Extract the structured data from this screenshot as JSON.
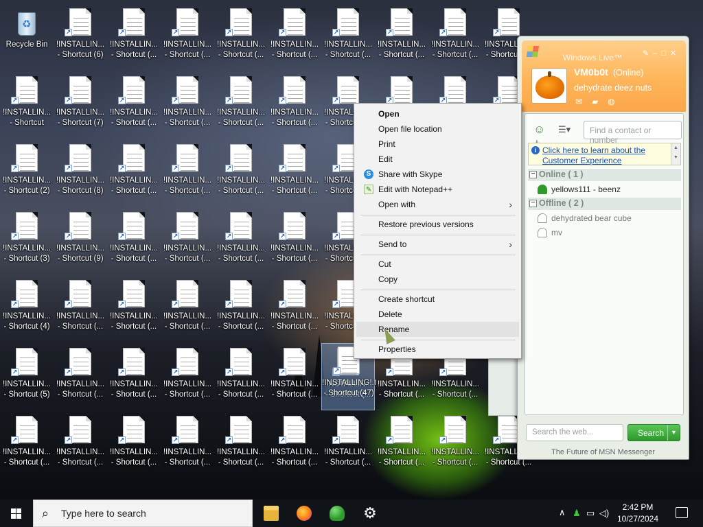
{
  "desktop": {
    "recycle_bin": "Recycle Bin",
    "shortcut_line1": "!INSTALLIN...",
    "rows": [
      [
        "- Shortcut (6)",
        "- Shortcut (...",
        "- Shortcut (...",
        "- Shortcut (...",
        "- Shortcut (...",
        "- Shortcut (...",
        "- Shortcut (...",
        "- Shortcut (...",
        "- Shortcut (..."
      ],
      [
        "- Shortcut",
        "- Shortcut (7)",
        "- Shortcut (...",
        "- Shortcut (...",
        "- Shortcut (...",
        "- Shortcut (...",
        "- Shortcut (...",
        "- Shortcut (...",
        "- Shortcut (...",
        "- Shortcut (..."
      ],
      [
        "- Shortcut (2)",
        "- Shortcut (8)",
        "- Shortcut (...",
        "- Shortcut (...",
        "- Shortcut (...",
        "- Shortcut (...",
        "- Shortcut (..."
      ],
      [
        "- Shortcut (3)",
        "- Shortcut (9)",
        "- Shortcut (...",
        "- Shortcut (...",
        "- Shortcut (...",
        "- Shortcut (...",
        "- Shortcut (..."
      ],
      [
        "- Shortcut (4)",
        "- Shortcut (...",
        "- Shortcut (...",
        "- Shortcut (...",
        "- Shortcut (...",
        "- Shortcut (...",
        "- Shortcut (..."
      ],
      [
        "- Shortcut (5)",
        "- Shortcut (...",
        "- Shortcut (...",
        "- Shortcut (...",
        "- Shortcut (...",
        "- Shortcut (...",
        "- Shortcut (...",
        "- Shortcut (...",
        "- Shortcut (..."
      ],
      [
        "- Shortcut (...",
        "- Shortcut (...",
        "- Shortcut (...",
        "- Shortcut (...",
        "- Shortcut (...",
        "- Shortcut (...",
        "- Shortcut (...",
        "- Shortcut (...",
        "- Shortcut (...",
        "- Shortcut (..."
      ]
    ],
    "selected_label": "!INSTALLING!.txt - Shortcut (47)"
  },
  "context_menu": {
    "open": "Open",
    "open_file_location": "Open file location",
    "print": "Print",
    "edit": "Edit",
    "share_skype": "Share with Skype",
    "edit_notepad": "Edit with Notepad++",
    "open_with": "Open with",
    "restore": "Restore previous versions",
    "send_to": "Send to",
    "cut": "Cut",
    "copy": "Copy",
    "create_shortcut": "Create shortcut",
    "delete": "Delete",
    "rename": "Rename",
    "properties": "Properties",
    "chevron": "›"
  },
  "msn": {
    "title": "Windows Live™",
    "username": "VM0b0t",
    "status": "(Online)",
    "personal_message": "dehydrate deez nuts",
    "find_placeholder": "Find a contact or number",
    "info_link": "Click here to learn about the Customer Experience",
    "online_group": "Online ( 1 )",
    "offline_group": "Offline ( 2 )",
    "online_contacts": [
      "yellows111 - beenz"
    ],
    "offline_contacts": [
      "dehydrated bear cube",
      "mv"
    ],
    "search_placeholder": "Search the web...",
    "search_button": "Search",
    "footer": "The Future of MSN Messenger"
  },
  "taskbar": {
    "search_placeholder": "Type here to search",
    "time": "2:42 PM",
    "date": "10/27/2024"
  }
}
